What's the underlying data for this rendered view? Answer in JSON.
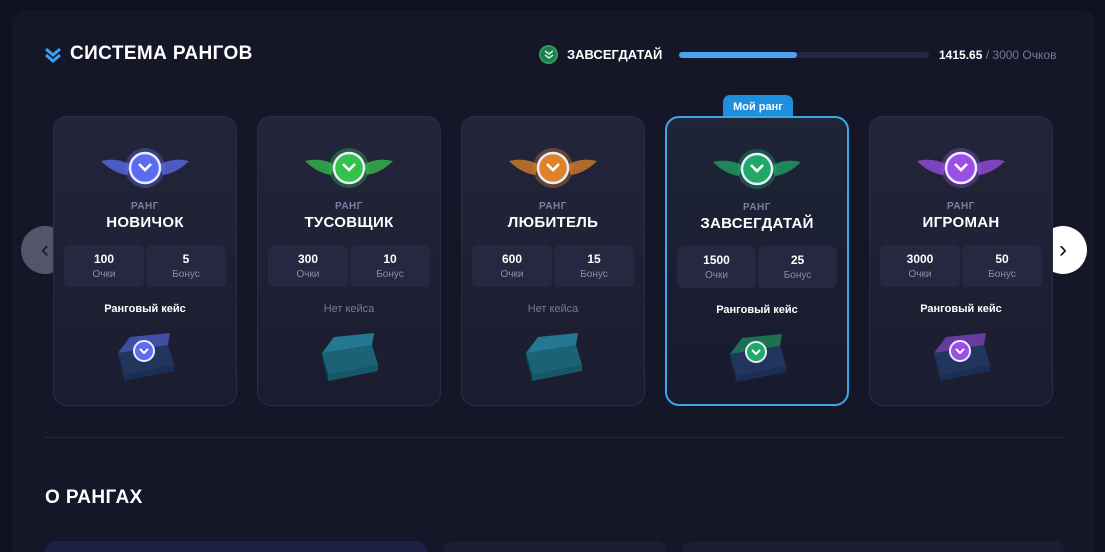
{
  "header": {
    "title": "СИСТЕМА РАНГОВ",
    "current_rank": "ЗАВСЕГДАТАЙ",
    "progress": 0.472,
    "points_current": "1415.65",
    "points_total": "/ 3000 Очков"
  },
  "nav": {
    "prev": "‹",
    "next": "›"
  },
  "my_rank_tag": "Мой ранг",
  "ranks": [
    {
      "sub": "РАНГ",
      "name": "НОВИЧОК",
      "points": "100",
      "points_label": "Очки",
      "bonus": "5",
      "bonus_label": "Бонус",
      "case": "Ранговый кейс",
      "color": "#5b6cf0"
    },
    {
      "sub": "РАНГ",
      "name": "ТУСОВЩИК",
      "points": "300",
      "points_label": "Очки",
      "bonus": "10",
      "bonus_label": "Бонус",
      "case": "Нет кейса",
      "color": "#35c24a"
    },
    {
      "sub": "РАНГ",
      "name": "ЛЮБИТЕЛЬ",
      "points": "600",
      "points_label": "Очки",
      "bonus": "15",
      "bonus_label": "Бонус",
      "case": "Нет кейса",
      "color": "#e0822a"
    },
    {
      "sub": "РАНГ",
      "name": "ЗАВСЕГДАТАЙ",
      "points": "1500",
      "points_label": "Очки",
      "bonus": "25",
      "bonus_label": "Бонус",
      "case": "Ранговый кейс",
      "color": "#1fa866"
    },
    {
      "sub": "РАНГ",
      "name": "ИГРОМАН",
      "points": "3000",
      "points_label": "Очки",
      "bonus": "50",
      "bonus_label": "Бонус",
      "case": "Ранговый кейс",
      "color": "#9b4fe6"
    }
  ],
  "about": {
    "title": "О РАНГАХ"
  }
}
